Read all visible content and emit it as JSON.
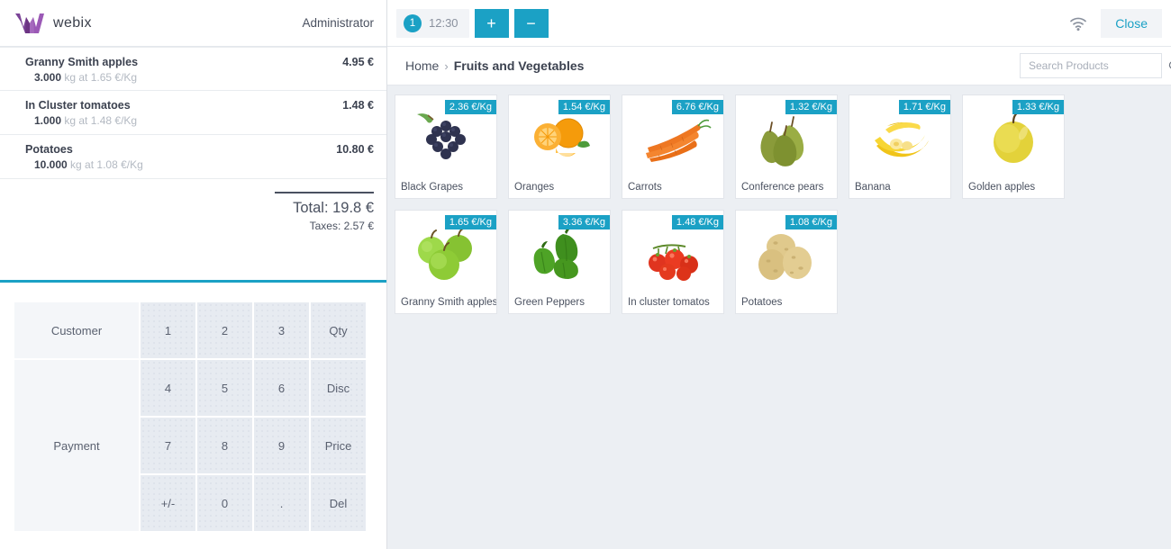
{
  "brand": {
    "name": "webix",
    "logo_icon": "webix-w-logo",
    "logo_color": "#8e44ad",
    "user_role": "Administrator"
  },
  "theme": {
    "accent": "#1ba1c5",
    "text": "#4a5160",
    "panel_bg": "#eceff3",
    "key_bg": "#e7ebf1"
  },
  "cart": {
    "items": [
      {
        "name": "Granny Smith apples",
        "qty": "3.000",
        "unit": "kg at 1.65 €/Kg",
        "total": "4.95 €"
      },
      {
        "name": "In Cluster tomatoes",
        "qty": "1.000",
        "unit": "kg at 1.48 €/Kg",
        "total": "1.48 €"
      },
      {
        "name": "Potatoes",
        "qty": "10.000",
        "unit": "kg at 1.08 €/Kg",
        "total": "10.80 €"
      }
    ],
    "total_label": "Total: 19.8 €",
    "taxes_label": "Taxes: 2.57 €"
  },
  "keypad": {
    "customer_label": "Customer",
    "payment_label": "Payment",
    "keys": [
      {
        "label": "1",
        "type": "key"
      },
      {
        "label": "2",
        "type": "key"
      },
      {
        "label": "3",
        "type": "key"
      },
      {
        "label": "Qty",
        "type": "key"
      },
      {
        "label": "4",
        "type": "key"
      },
      {
        "label": "5",
        "type": "key"
      },
      {
        "label": "6",
        "type": "key"
      },
      {
        "label": "Disc",
        "type": "key"
      },
      {
        "label": "7",
        "type": "key"
      },
      {
        "label": "8",
        "type": "key"
      },
      {
        "label": "9",
        "type": "key"
      },
      {
        "label": "Price",
        "type": "key"
      },
      {
        "label": "+/-",
        "type": "key"
      },
      {
        "label": "0",
        "type": "key"
      },
      {
        "label": ".",
        "type": "key"
      },
      {
        "label": "Del",
        "type": "key"
      }
    ]
  },
  "toolbar": {
    "session_badge": "1",
    "session_time": "12:30",
    "add_label": "+",
    "remove_label": "−",
    "wifi_icon": "wifi-icon",
    "close_label": "Close"
  },
  "breadcrumb": {
    "home": "Home",
    "separator": "›",
    "current": "Fruits and Vegetables"
  },
  "search": {
    "placeholder": "Search Products",
    "value": "",
    "icon": "search-icon"
  },
  "products": [
    {
      "name": "Black Grapes",
      "price": "2.36 €/Kg",
      "image": "grapes"
    },
    {
      "name": "Oranges",
      "price": "1.54 €/Kg",
      "image": "oranges"
    },
    {
      "name": "Carrots",
      "price": "6.76 €/Kg",
      "image": "carrots"
    },
    {
      "name": "Conference pears",
      "price": "1.32 €/Kg",
      "image": "pears"
    },
    {
      "name": "Banana",
      "price": "1.71 €/Kg",
      "image": "banana"
    },
    {
      "name": "Golden apples",
      "price": "1.33 €/Kg",
      "image": "golden-apple"
    },
    {
      "name": "Granny Smith apples",
      "price": "1.65 €/Kg",
      "image": "green-apples"
    },
    {
      "name": "Green Peppers",
      "price": "3.36 €/Kg",
      "image": "peppers"
    },
    {
      "name": "In cluster tomatos",
      "price": "1.48 €/Kg",
      "image": "tomatoes"
    },
    {
      "name": "Potatoes",
      "price": "1.08 €/Kg",
      "image": "potatoes"
    }
  ]
}
